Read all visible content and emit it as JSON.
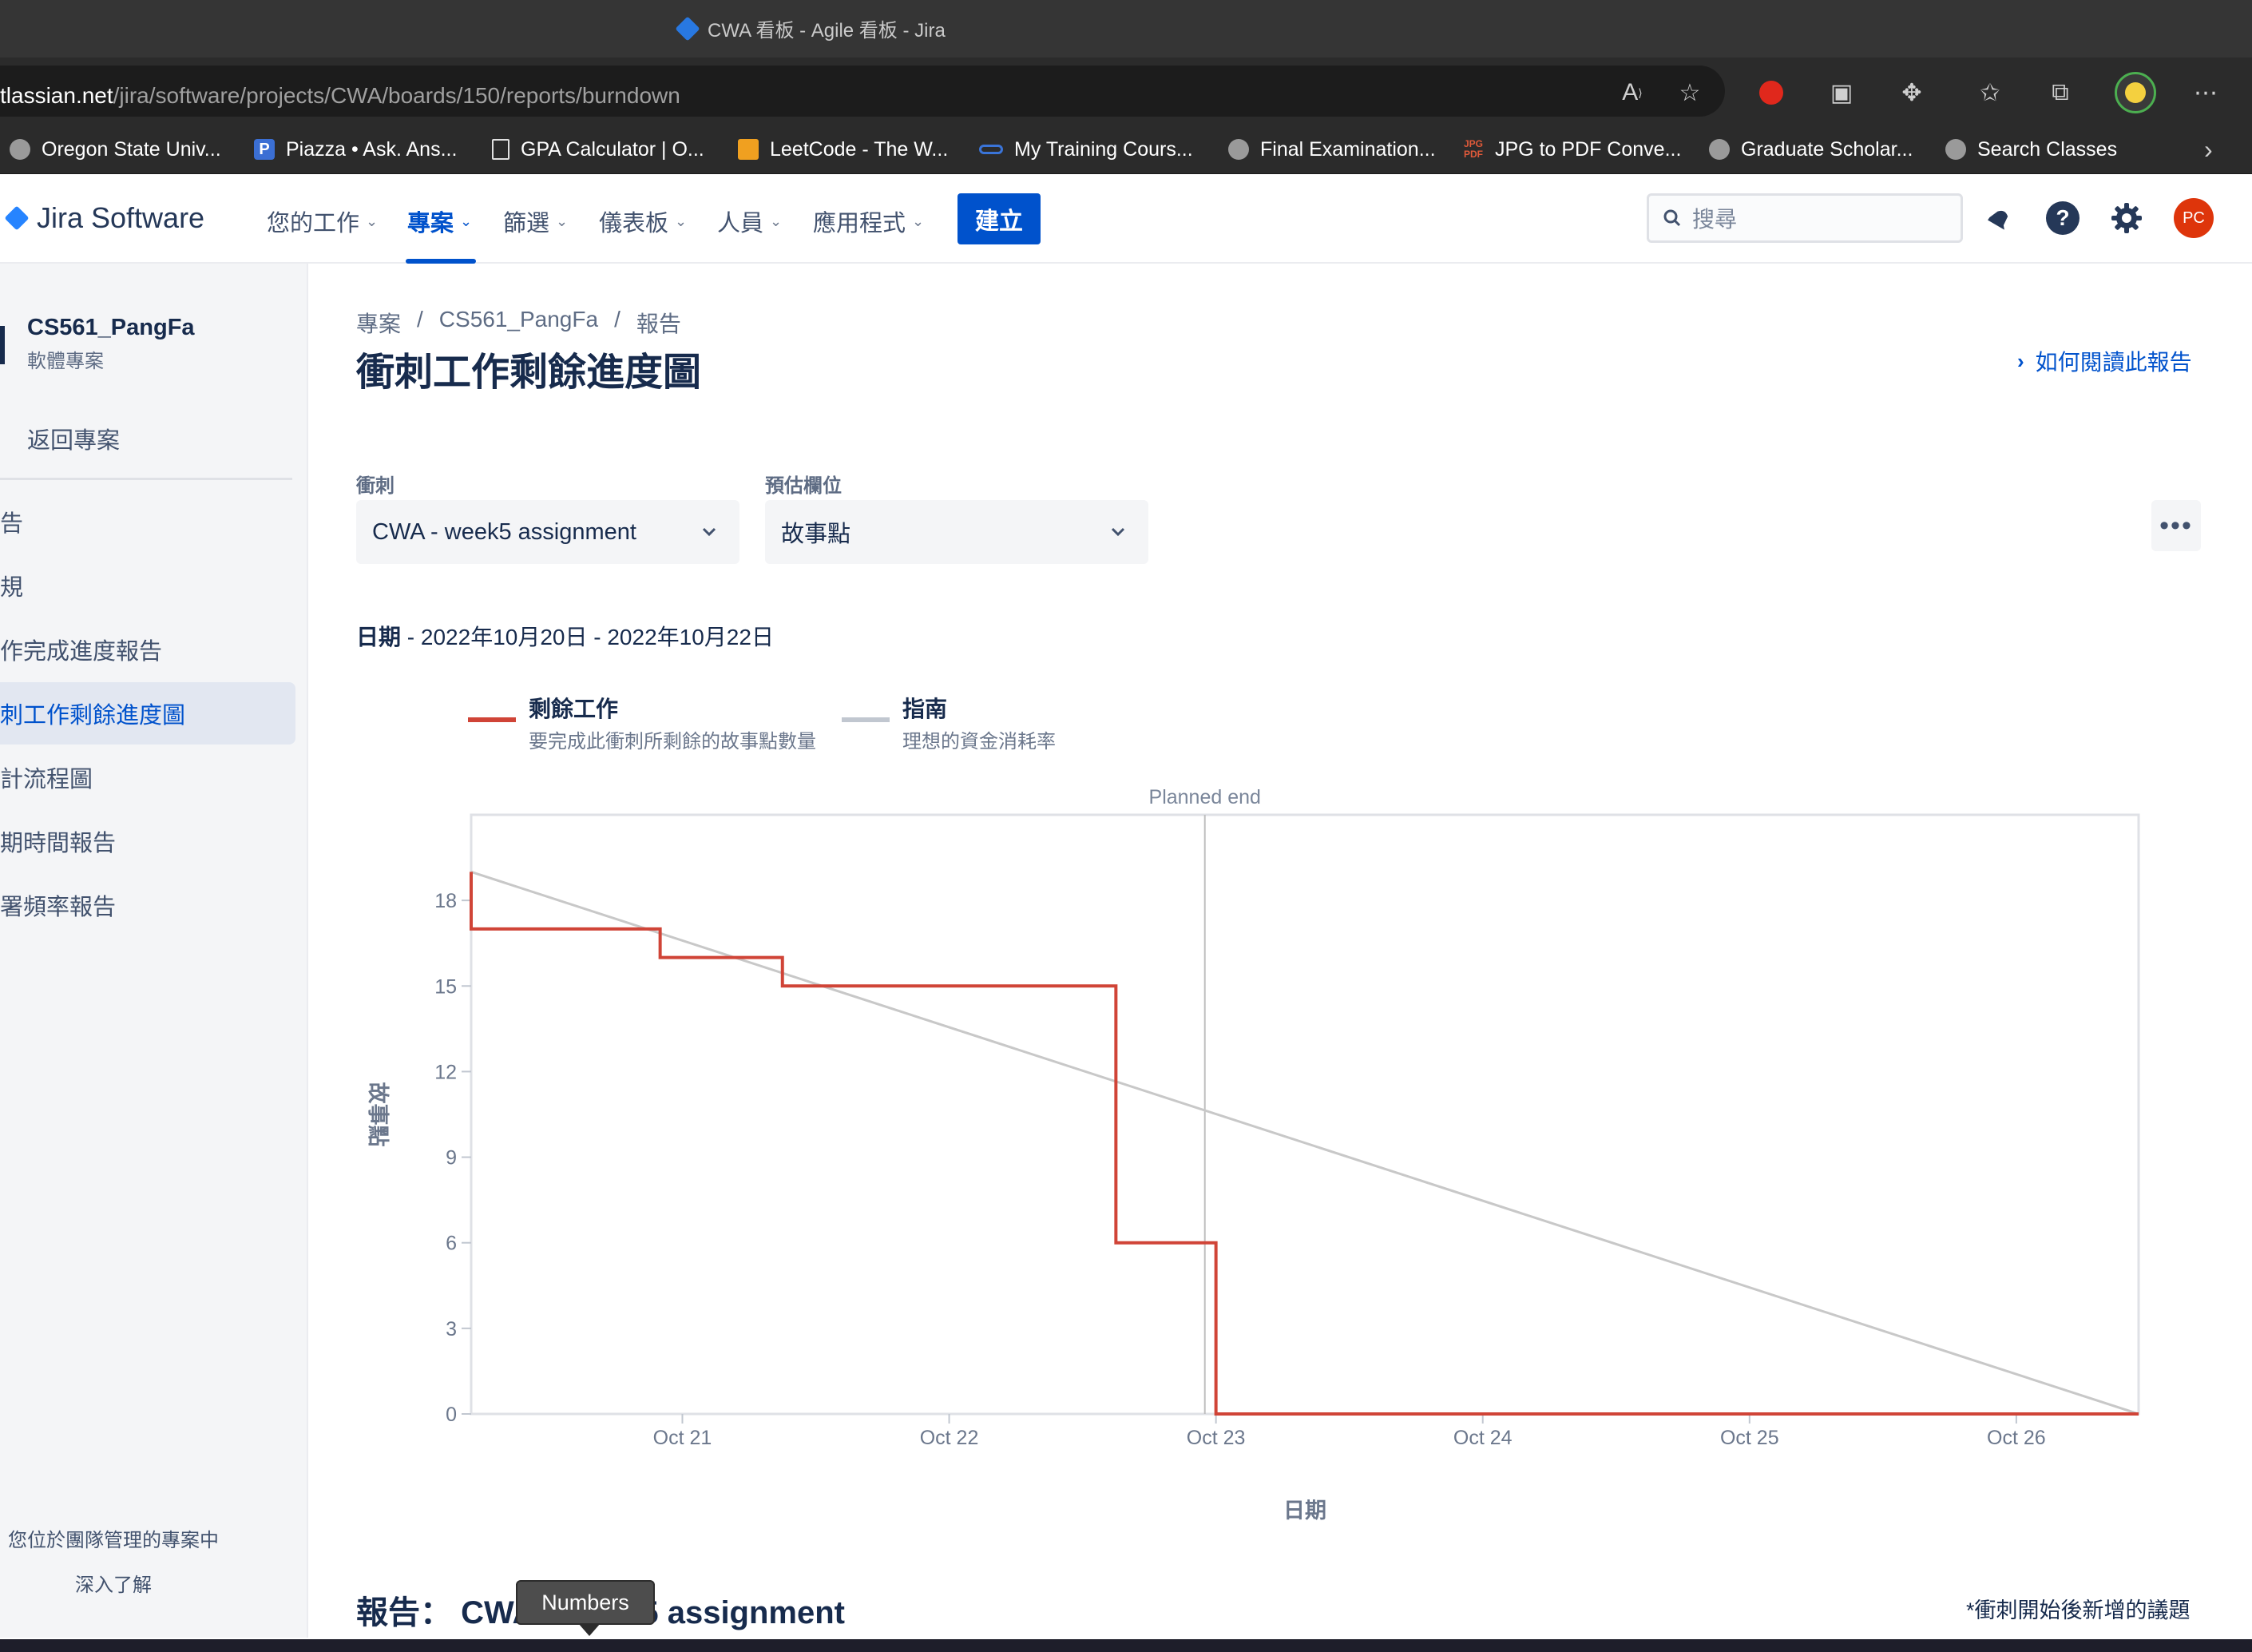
{
  "browser": {
    "window_title": "CWA 看板 - Agile 看板 - Jira",
    "url_host": "tlassian.net",
    "url_path": "/jira/software/projects/CWA/boards/150/reports/burndown",
    "bookmarks": [
      {
        "label": "Oregon State Univ...",
        "icon": "globe-icon"
      },
      {
        "label": "Piazza • Ask. Ans...",
        "icon": "piazza-icon"
      },
      {
        "label": "GPA Calculator | O...",
        "icon": "document-icon"
      },
      {
        "label": "LeetCode - The W...",
        "icon": "leetcode-icon"
      },
      {
        "label": "My Training Cours...",
        "icon": "link-icon"
      },
      {
        "label": "Final Examination...",
        "icon": "globe-icon"
      },
      {
        "label": "JPG to PDF Conve...",
        "icon": "jpg-pdf-icon"
      },
      {
        "label": "Graduate Scholar...",
        "icon": "globe-icon"
      },
      {
        "label": "Search Classes",
        "icon": "globe-icon"
      }
    ]
  },
  "nav": {
    "logo": "Jira Software",
    "items": [
      "您的工作",
      "專案",
      "篩選",
      "儀表板",
      "人員",
      "應用程式"
    ],
    "active_item": "專案",
    "create": "建立",
    "search_placeholder": "搜尋",
    "avatar_initials": "PC",
    "accent_color": "#0052cc"
  },
  "sidebar": {
    "project_name": "CS561_PangFa",
    "project_type": "軟體專案",
    "back": "返回專案",
    "items": [
      "告",
      "規",
      "作完成進度報告",
      "刺工作剩餘進度圖",
      "計流程圖",
      "期時間報告",
      "署頻率報告"
    ],
    "active_index": 3,
    "footer_text": "您位於團隊管理的專案中",
    "footer_link": "深入了解"
  },
  "main": {
    "breadcrumbs": [
      "專案",
      "CS561_PangFa",
      "報告"
    ],
    "title": "衝刺工作剩餘進度圖",
    "help_link": "如何閱讀此報告",
    "sprint_label": "衝刺",
    "sprint_value": "CWA - week5 assignment",
    "estimate_label": "預估欄位",
    "estimate_value": "故事點",
    "date_label": "日期",
    "date_range": " - 2022年10月20日 - 2022年10月22日",
    "legend": [
      {
        "title": "剩餘工作",
        "subtitle": "要完成此衝刺所剩餘的故事點數量",
        "color": "#d04437"
      },
      {
        "title": "指南",
        "subtitle": "理想的資金消耗率",
        "color": "#c1c7d0"
      }
    ],
    "report_title": "報告： CWA - week5 assignment",
    "tooltip": "Numbers",
    "footnote": "*衝刺開始後新增的議題"
  },
  "chart_data": {
    "type": "line",
    "title": "",
    "xlabel": "日期",
    "ylabel": "故事點",
    "x_range": [
      "2022-10-20 05:00",
      "2022-10-26 11:00"
    ],
    "ylim": [
      0,
      21
    ],
    "y_ticks": [
      0,
      3,
      6,
      9,
      12,
      15,
      18
    ],
    "x_tick_labels": [
      "Oct 21",
      "Oct 22",
      "Oct 23",
      "Oct 24",
      "Oct 25",
      "Oct 26"
    ],
    "x_tick_dates": [
      "2022-10-21",
      "2022-10-22",
      "2022-10-23",
      "2022-10-24",
      "2022-10-25",
      "2022-10-26"
    ],
    "annotation": {
      "label": "Planned end",
      "x": "2022-10-22 23:00"
    },
    "series": [
      {
        "name": "剩餘工作",
        "color": "#d04437",
        "step": true,
        "points": [
          {
            "x": "2022-10-20 05:00",
            "y": 19
          },
          {
            "x": "2022-10-20 05:00",
            "y": 17
          },
          {
            "x": "2022-10-20 22:00",
            "y": 16
          },
          {
            "x": "2022-10-21 09:00",
            "y": 15
          },
          {
            "x": "2022-10-22 15:00",
            "y": 6
          },
          {
            "x": "2022-10-23 00:00",
            "y": 0
          },
          {
            "x": "2022-10-26 11:00",
            "y": 0
          }
        ]
      },
      {
        "name": "指南",
        "color": "#c8c8c8",
        "step": false,
        "points": [
          {
            "x": "2022-10-20 05:00",
            "y": 19
          },
          {
            "x": "2022-10-26 11:00",
            "y": 0
          }
        ]
      }
    ]
  }
}
